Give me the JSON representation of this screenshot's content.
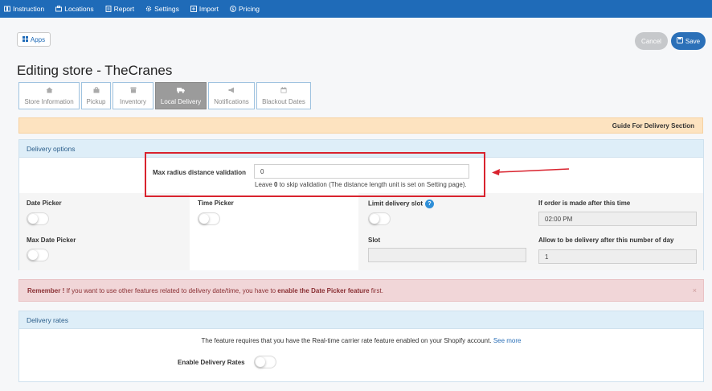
{
  "nav": [
    {
      "label": "Instruction",
      "icon": "book-icon"
    },
    {
      "label": "Locations",
      "icon": "locations-icon"
    },
    {
      "label": "Report",
      "icon": "report-icon"
    },
    {
      "label": "Settings",
      "icon": "gear-icon"
    },
    {
      "label": "Import",
      "icon": "import-icon"
    },
    {
      "label": "Pricing",
      "icon": "dollar-icon"
    }
  ],
  "apps_label": "Apps",
  "cancel_label": "Cancel",
  "save_label": "Save",
  "page_title": "Editing store - TheCranes",
  "tabs": [
    {
      "label": "Store Information",
      "icon": "home-icon"
    },
    {
      "label": "Pickup",
      "icon": "bag-icon"
    },
    {
      "label": "Inventory",
      "icon": "inventory-icon"
    },
    {
      "label": "Local Delivery",
      "icon": "truck-icon",
      "active": true
    },
    {
      "label": "Notifications",
      "icon": "megaphone-icon"
    },
    {
      "label": "Blackout Dates",
      "icon": "calendar-icon"
    }
  ],
  "guide_label": "Guide For Delivery Section",
  "delivery_options": {
    "title": "Delivery options",
    "max_radius_label": "Max radius distance validation",
    "max_radius_value": "0",
    "max_radius_help_prefix": "Leave ",
    "max_radius_help_bold": "0",
    "max_radius_help_suffix": " to skip validation (The distance length unit is set on Setting page).",
    "date_picker_label": "Date Picker",
    "time_picker_label": "Time Picker",
    "limit_slot_label": "Limit delivery slot",
    "limit_slot_help": "?",
    "order_after_label": "If order is made after this time",
    "order_after_value": "02:00 PM",
    "max_date_label": "Max Date Picker",
    "slot_label": "Slot",
    "slot_value": "",
    "allow_days_label": "Allow to be delivery after this number of day",
    "allow_days_value": "1"
  },
  "alert": {
    "prefix_bold": "Remember !",
    "middle": " If you want to use other features related to delivery date/time, you have to ",
    "feature_bold": "enable the Date Picker feature",
    "suffix": " first.",
    "close": "×"
  },
  "delivery_rates": {
    "title": "Delivery rates",
    "info_text": "The feature requires that you have the Real-time carrier rate feature enabled on your Shopify account. ",
    "see_more": "See more",
    "enable_label": "Enable Delivery Rates"
  },
  "colors": {
    "nav_bg": "#1f6bb8",
    "highlight": "#d9232e",
    "active_tab": "#9b9b9b"
  }
}
